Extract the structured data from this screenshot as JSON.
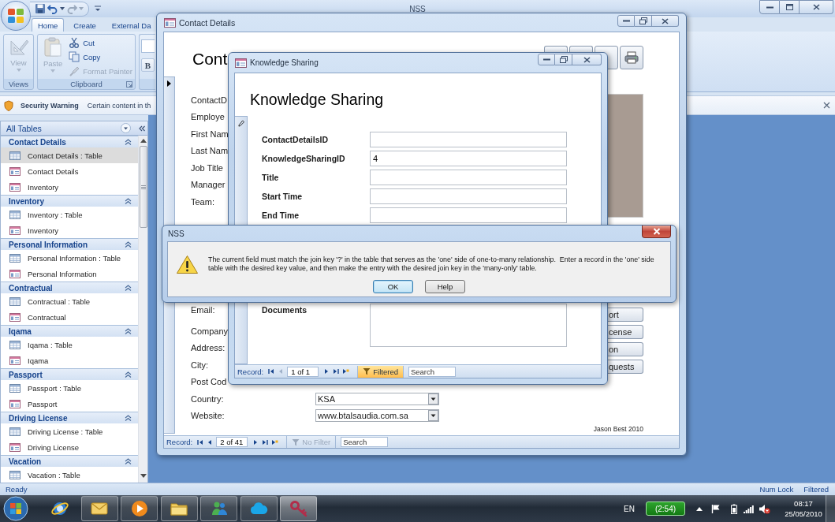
{
  "app": {
    "title": "NSS"
  },
  "ribbon": {
    "tabs": [
      {
        "label": "Home",
        "selected": true
      },
      {
        "label": "Create",
        "selected": false
      },
      {
        "label": "External Da",
        "selected": false
      }
    ],
    "views": {
      "label": "Views",
      "button": {
        "label": "View",
        "disabled": true
      }
    },
    "clipboard": {
      "label": "Clipboard",
      "paste": {
        "label": "Paste",
        "disabled": true
      },
      "items": [
        {
          "label": "Cut",
          "disabled": false
        },
        {
          "label": "Copy",
          "disabled": false
        },
        {
          "label": "Format Painter",
          "disabled": true
        }
      ]
    },
    "font": {
      "bold_label": "B"
    }
  },
  "security_bar": {
    "title": "Security Warning",
    "message": "Certain content in th"
  },
  "nav_pane": {
    "title": "All Tables",
    "groups": [
      {
        "name": "Contact Details",
        "expanded": true,
        "items": [
          {
            "label": "Contact Details : Table",
            "kind": "table",
            "selected": true
          },
          {
            "label": "Contact Details",
            "kind": "form",
            "selected": false
          },
          {
            "label": "Inventory",
            "kind": "form",
            "selected": false
          }
        ]
      },
      {
        "name": "Inventory",
        "expanded": true,
        "items": [
          {
            "label": "Inventory : Table",
            "kind": "table",
            "selected": false
          },
          {
            "label": "Inventory",
            "kind": "form",
            "selected": false
          }
        ]
      },
      {
        "name": "Personal Information",
        "expanded": true,
        "items": [
          {
            "label": "Personal Information : Table",
            "kind": "table",
            "selected": false
          },
          {
            "label": "Personal Information",
            "kind": "form",
            "selected": false
          }
        ]
      },
      {
        "name": "Contractual",
        "expanded": true,
        "items": [
          {
            "label": "Contractual : Table",
            "kind": "table",
            "selected": false
          },
          {
            "label": "Contractual",
            "kind": "form",
            "selected": false
          }
        ]
      },
      {
        "name": "Iqama",
        "expanded": true,
        "items": [
          {
            "label": "Iqama : Table",
            "kind": "table",
            "selected": false
          },
          {
            "label": "Iqama",
            "kind": "form",
            "selected": false
          }
        ]
      },
      {
        "name": "Passport",
        "expanded": true,
        "items": [
          {
            "label": "Passport : Table",
            "kind": "table",
            "selected": false
          },
          {
            "label": "Passport",
            "kind": "form",
            "selected": false
          }
        ]
      },
      {
        "name": "Driving License",
        "expanded": true,
        "items": [
          {
            "label": "Driving License : Table",
            "kind": "table",
            "selected": false
          },
          {
            "label": "Driving License",
            "kind": "form",
            "selected": false
          }
        ]
      },
      {
        "name": "Vacation",
        "expanded": true,
        "items": [
          {
            "label": "Vacation : Table",
            "kind": "table",
            "selected": false
          }
        ]
      }
    ]
  },
  "contact_window": {
    "title": "Contact Details",
    "heading": "Cont",
    "editing": false,
    "labels_top": [
      "ContactD",
      "Employe",
      "First Nam",
      "Last Nam",
      "Job Title",
      "Manager",
      "Team:"
    ],
    "email_label": "Email:",
    "rows_bottom": [
      {
        "label": "Company"
      },
      {
        "label": "Address:"
      },
      {
        "label": "City:"
      },
      {
        "label": "Post Cod"
      },
      {
        "label": "Country:",
        "value": "KSA"
      },
      {
        "label": "Website:",
        "value": "www.btalsaudia.com.sa"
      }
    ],
    "side_buttons": [
      "ort",
      "cense",
      "on",
      "quests"
    ],
    "footer": "Jason Best 2010",
    "record_nav": {
      "label": "Record:",
      "position": "2 of 41",
      "filter": "No Filter",
      "filter_active": false,
      "search_placeholder": "Search"
    }
  },
  "ks_window": {
    "title": "Knowledge Sharing",
    "heading": "Knowledge Sharing",
    "editing": true,
    "fields": [
      {
        "label": "ContactDetailsID"
      },
      {
        "label": "KnowledgeSharingID",
        "value": "4"
      },
      {
        "label": "Title"
      },
      {
        "label": "Start Time"
      },
      {
        "label": "End Time"
      }
    ],
    "memo": {
      "label": "Documents"
    },
    "record_nav": {
      "label": "Record:",
      "position": "1 of 1",
      "filter": "Filtered",
      "filter_active": true,
      "search_placeholder": "Search"
    }
  },
  "dialog": {
    "title": "NSS",
    "message": "The current field must match the join key '?' in the table that serves as the 'one' side of one-to-many relationship.  Enter a record in the 'one' side table with the desired key value, and then make the entry with the desired join key in the 'many-only' table.",
    "buttons": [
      {
        "label": "OK",
        "default": true
      },
      {
        "label": "Help",
        "default": false
      }
    ]
  },
  "status_bar": {
    "left": "Ready",
    "right": [
      "Num Lock",
      "Filtered"
    ]
  },
  "taskbar": {
    "apps": [
      {
        "running": false,
        "selected": false
      },
      {
        "running": true,
        "selected": false
      },
      {
        "running": true,
        "selected": false
      },
      {
        "running": true,
        "selected": false
      },
      {
        "running": true,
        "selected": false
      },
      {
        "running": true,
        "selected": false
      },
      {
        "running": true,
        "selected": true
      }
    ],
    "language": "EN",
    "battery": "(2:54)",
    "time": "08:17",
    "date": "25/05/2010"
  }
}
